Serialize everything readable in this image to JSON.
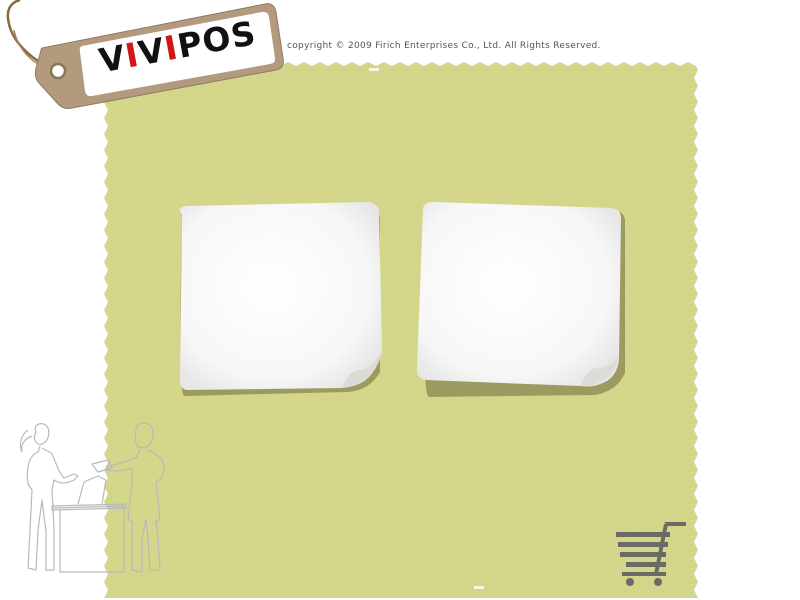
{
  "brand": {
    "logo_text": "ViViPOS",
    "copyright": "copyright © 2009 Firich Enterprises Co., Ltd. All Rights Reserved."
  },
  "colors": {
    "paper": "#d5d88a",
    "paper_edge": "#cfd382",
    "note": "#ffffff",
    "tag": "#b39a7e",
    "logo_red": "#d01818"
  },
  "icons": {
    "cart": "shopping-cart-icon",
    "illustration": "cashier-customer-illustration"
  }
}
